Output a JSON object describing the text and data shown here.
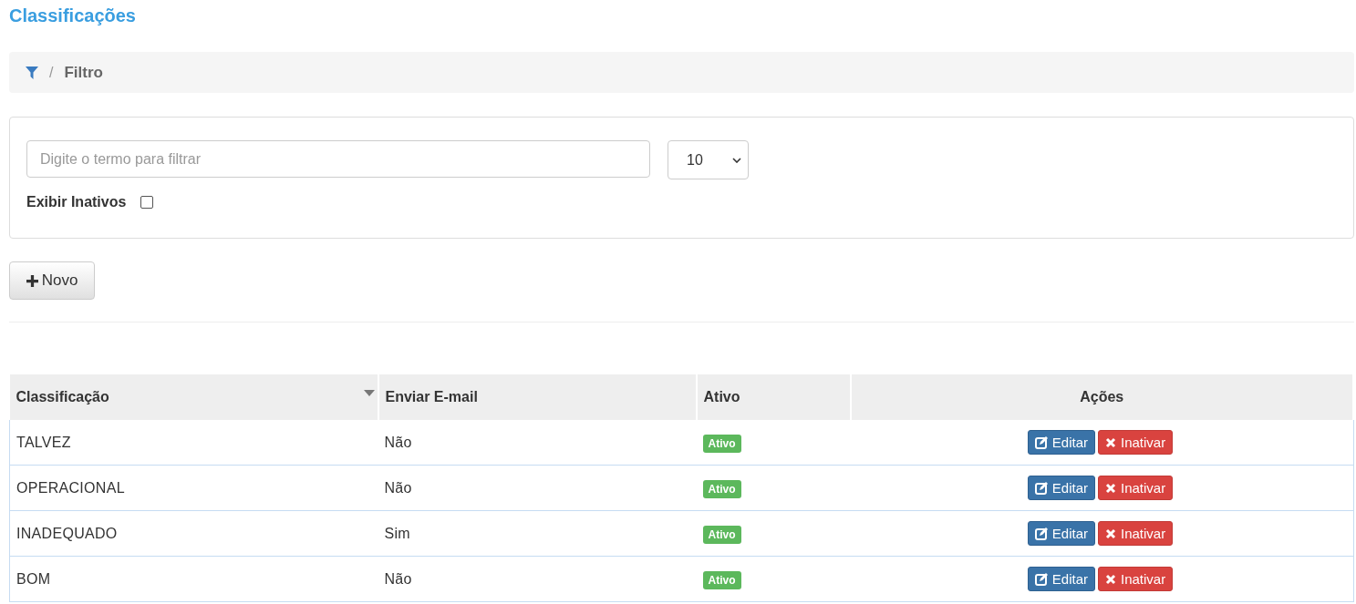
{
  "page_title": "Classificações",
  "breadcrumb": {
    "separator": "/",
    "label": "Filtro"
  },
  "filter": {
    "search": {
      "placeholder": "Digite o termo para filtrar"
    },
    "page_size": "10",
    "show_inactive": {
      "label": "Exibir Inativos",
      "checked": false
    }
  },
  "new_button": {
    "label": "Novo"
  },
  "table": {
    "columns": [
      {
        "label": "Classificação",
        "sorted": true
      },
      {
        "label": "Enviar E-mail",
        "sorted": false
      },
      {
        "label": "Ativo",
        "sorted": false
      },
      {
        "label": "Ações",
        "sorted": false
      }
    ],
    "rows": [
      {
        "name": "TALVEZ",
        "send_email": "Não",
        "status": "Ativo",
        "actions": [
          {
            "kind": "edit",
            "label": "Editar"
          },
          {
            "kind": "deactivate",
            "label": "Inativar"
          }
        ]
      },
      {
        "name": "OPERACIONAL",
        "send_email": "Não",
        "status": "Ativo",
        "actions": [
          {
            "kind": "edit",
            "label": "Editar"
          },
          {
            "kind": "deactivate",
            "label": "Inativar"
          }
        ]
      },
      {
        "name": "INADEQUADO",
        "send_email": "Sim",
        "status": "Ativo",
        "actions": [
          {
            "kind": "edit",
            "label": "Editar"
          },
          {
            "kind": "deactivate",
            "label": "Inativar"
          }
        ]
      },
      {
        "name": "BOM",
        "send_email": "Não",
        "status": "Ativo",
        "actions": [
          {
            "kind": "edit",
            "label": "Editar"
          },
          {
            "kind": "deactivate",
            "label": "Inativar"
          }
        ]
      }
    ]
  }
}
